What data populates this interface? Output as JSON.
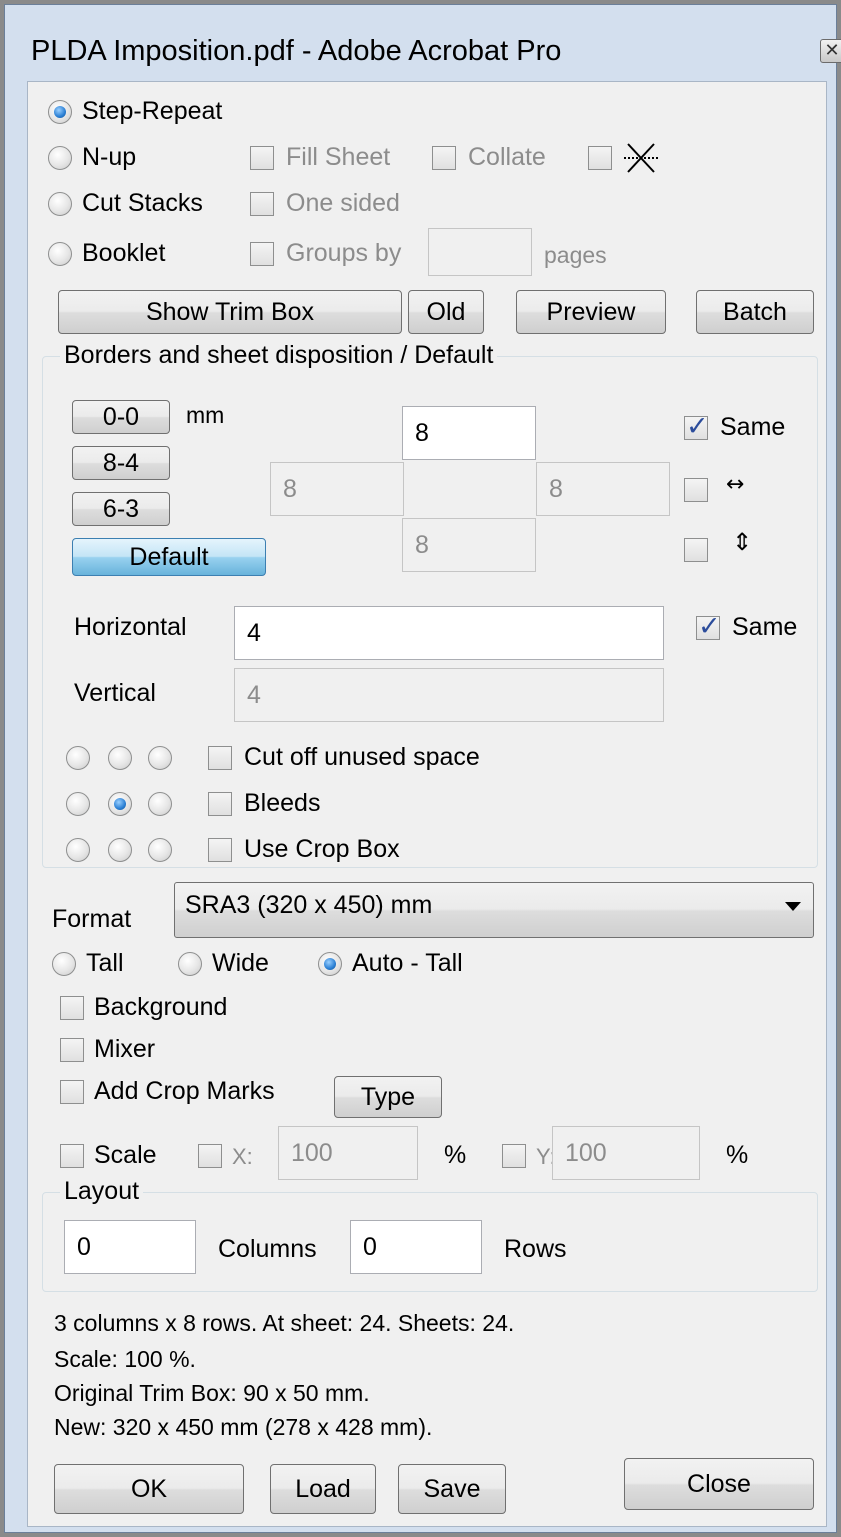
{
  "window": {
    "title": "PLDA Imposition.pdf - Adobe Acrobat Pro",
    "close_glyph": "✕"
  },
  "mode": {
    "step_repeat": "Step-Repeat",
    "nup": "N-up",
    "cut_stacks": "Cut Stacks",
    "booklet": "Booklet",
    "fill_sheet": "Fill Sheet",
    "collate": "Collate",
    "one_sided": "One sided",
    "groups_by": "Groups by",
    "groups_by_value": "",
    "pages": "pages",
    "selected": "step_repeat"
  },
  "toolbar": {
    "show_trim_box": "Show Trim Box",
    "old": "Old",
    "preview": "Preview",
    "batch": "Batch"
  },
  "borders": {
    "legend": "Borders and sheet disposition / Default",
    "preset_00": "0-0",
    "preset_84": "8-4",
    "preset_63": "6-3",
    "preset_default": "Default",
    "unit": "mm",
    "top": "8",
    "left": "8",
    "right": "8",
    "bottom": "8",
    "same": "Same",
    "horizontal_label": "Horizontal",
    "horizontal": "4",
    "vertical_label": "Vertical",
    "vertical": "4",
    "same2": "Same",
    "cut_off": "Cut off unused space",
    "bleeds": "Bleeds",
    "use_crop_box": "Use Crop Box",
    "h_arrow": "↔",
    "v_arrow": "⇕"
  },
  "format": {
    "label": "Format",
    "value": "SRA3 (320 x 450) mm",
    "tall": "Tall",
    "wide": "Wide",
    "auto_tall": "Auto - Tall",
    "background": "Background",
    "mixer": "Mixer",
    "add_crop_marks": "Add Crop Marks",
    "type": "Type",
    "scale": "Scale",
    "x_label": "X:",
    "x_value": "100",
    "y_label": "Y:",
    "y_value": "100",
    "percent": "%"
  },
  "layout": {
    "legend": "Layout",
    "columns_value": "0",
    "columns_label": "Columns",
    "rows_value": "0",
    "rows_label": "Rows"
  },
  "status": {
    "line1": "3 columns x 8 rows. At sheet: 24. Sheets: 24.",
    "line2": "Scale: 100 %.",
    "line3": "Original Trim Box: 90 x 50 mm.",
    "line4": "New: 320 x 450 mm (278 x 428 mm)."
  },
  "footer": {
    "ok": "OK",
    "load": "Load",
    "save": "Save",
    "close": "Close"
  }
}
